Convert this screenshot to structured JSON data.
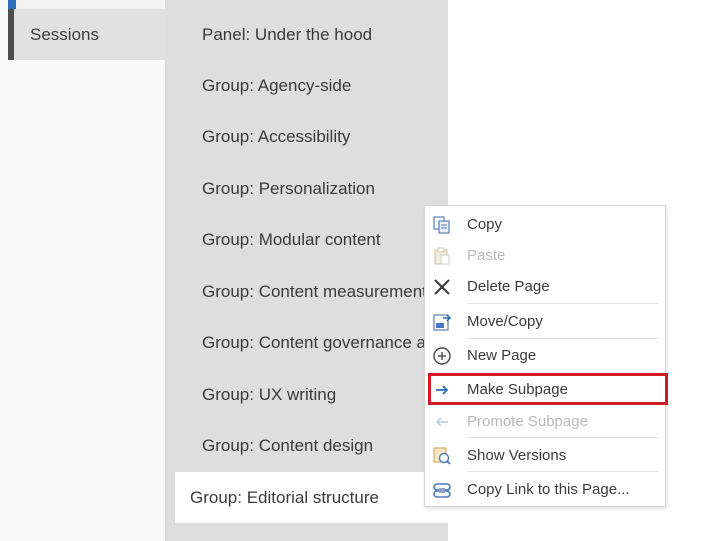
{
  "sections": {
    "items": [
      {
        "label": "Sessions"
      }
    ]
  },
  "pages": {
    "items": [
      {
        "label": "Panel: Under the hood"
      },
      {
        "label": "Group: Agency-side"
      },
      {
        "label": "Group: Accessibility"
      },
      {
        "label": "Group: Personalization"
      },
      {
        "label": "Group: Modular content"
      },
      {
        "label": "Group: Content measurement"
      },
      {
        "label": "Group: Content governance and"
      },
      {
        "label": "Group: UX writing"
      },
      {
        "label": "Group: Content design"
      },
      {
        "label": "Group: Editorial structure"
      }
    ],
    "selected_index": 9
  },
  "context_menu": {
    "items": [
      {
        "label": "Copy",
        "icon": "copy-icon",
        "enabled": true
      },
      {
        "label": "Paste",
        "icon": "paste-icon",
        "enabled": false
      },
      {
        "label": "Delete Page",
        "icon": "delete-x-icon",
        "enabled": true
      },
      {
        "label": "Move/Copy",
        "icon": "move-copy-icon",
        "enabled": true
      },
      {
        "label": "New Page",
        "icon": "add-circle-icon",
        "enabled": true
      },
      {
        "label": "Make Subpage",
        "icon": "arrow-right-icon",
        "enabled": true,
        "highlighted": true
      },
      {
        "label": "Promote Subpage",
        "icon": "arrow-left-icon",
        "enabled": false
      },
      {
        "label": "Show Versions",
        "icon": "versions-icon",
        "enabled": true
      },
      {
        "label": "Copy Link to this Page...",
        "icon": "link-icon",
        "enabled": true
      }
    ]
  },
  "colors": {
    "accent": "#2b6fba",
    "highlight_border": "#d11a24"
  }
}
